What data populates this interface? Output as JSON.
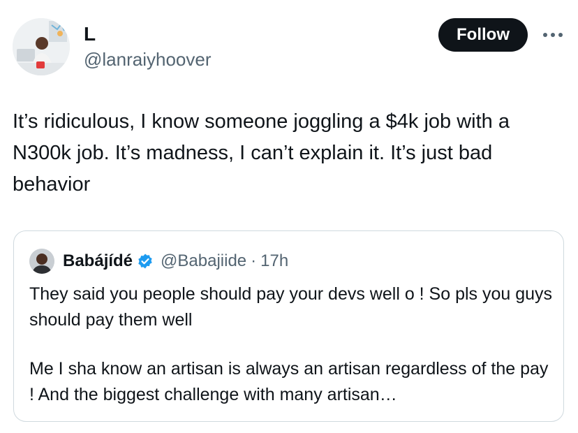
{
  "author": {
    "name": "L",
    "handle": "@lanraiyhoover"
  },
  "actions": {
    "follow_label": "Follow",
    "more_icon": "more-horizontal-icon"
  },
  "tweet": {
    "text": "It’s ridiculous, I know someone joggling a $4k job with a N300k job. It’s madness, I can’t explain it. It’s just bad behavior"
  },
  "quoted": {
    "name": "Babájídé",
    "verified_icon": "verified-badge-icon",
    "handle": "@Babajiide",
    "separator": "·",
    "time": "17h",
    "paragraph1": "They said you people should pay your devs well o ! So pls you guys should pay them well",
    "paragraph2": "Me I sha know an artisan is always an artisan regardless of the pay ! And the biggest challenge with many artisan…"
  },
  "colors": {
    "text": "#0f1419",
    "secondary": "#536471",
    "border": "#cfd9de",
    "verified": "#1d9bf0",
    "button": "#0f1419"
  }
}
